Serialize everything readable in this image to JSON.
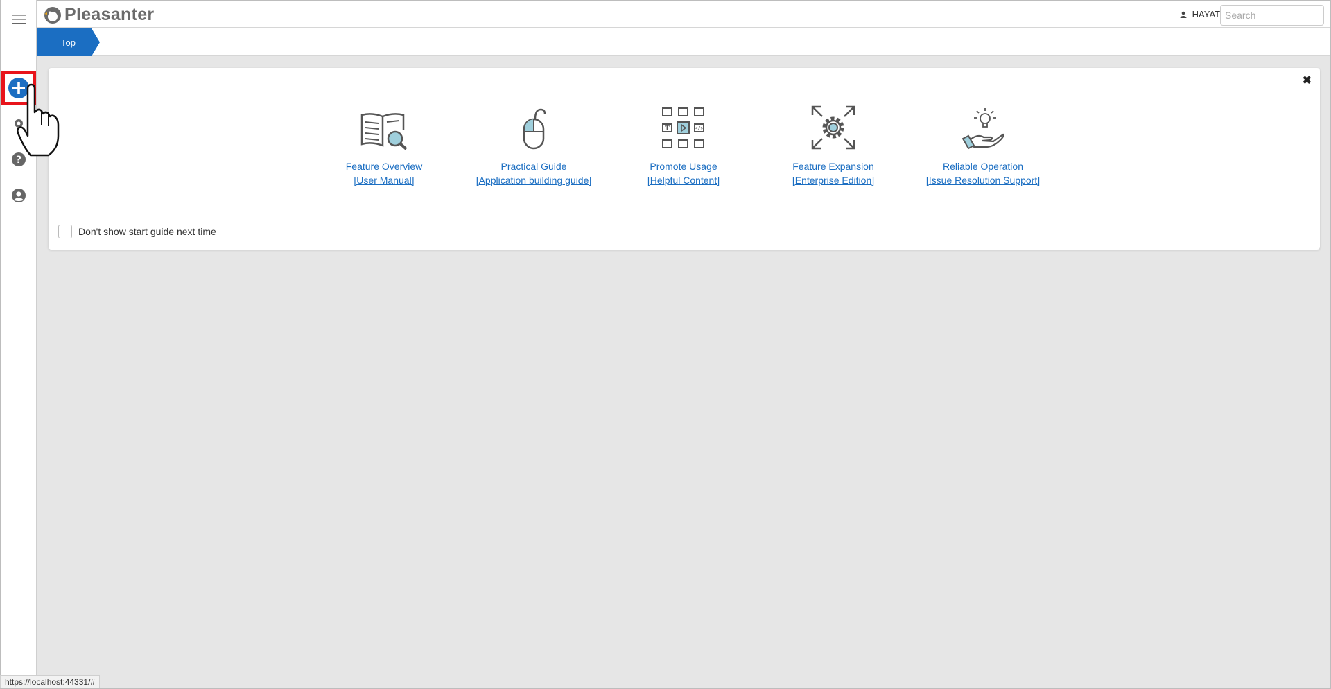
{
  "app": {
    "name": "Pleasanter"
  },
  "header": {
    "username": "HAYATO",
    "search_placeholder": "Search"
  },
  "breadcrumb": {
    "top_label": "Top"
  },
  "guide": {
    "items": [
      {
        "title": "Feature Overview",
        "subtitle": "[User Manual]",
        "icon": "book-magnifier-icon"
      },
      {
        "title": "Practical Guide",
        "subtitle": "[Application building guide]",
        "icon": "mouse-icon"
      },
      {
        "title": "Promote Usage",
        "subtitle": "[Helpful Content]",
        "icon": "content-grid-icon"
      },
      {
        "title": "Feature Expansion",
        "subtitle": "[Enterprise Edition]",
        "icon": "gear-expand-icon"
      },
      {
        "title": "Reliable Operation",
        "subtitle": "[Issue Resolution Support]",
        "icon": "hand-lightbulb-icon"
      }
    ],
    "dont_show_label": "Don't show start guide next time",
    "close_symbol": "✖"
  },
  "sidebar": {
    "icons": [
      "menu-icon",
      "add-icon",
      "settings-icon",
      "help-icon",
      "user-icon"
    ]
  },
  "status_url": "https://localhost:44331/#",
  "colors": {
    "accent": "#1b6ec2",
    "highlight": "#e8141b",
    "icon_fill": "#9fcfdc"
  }
}
